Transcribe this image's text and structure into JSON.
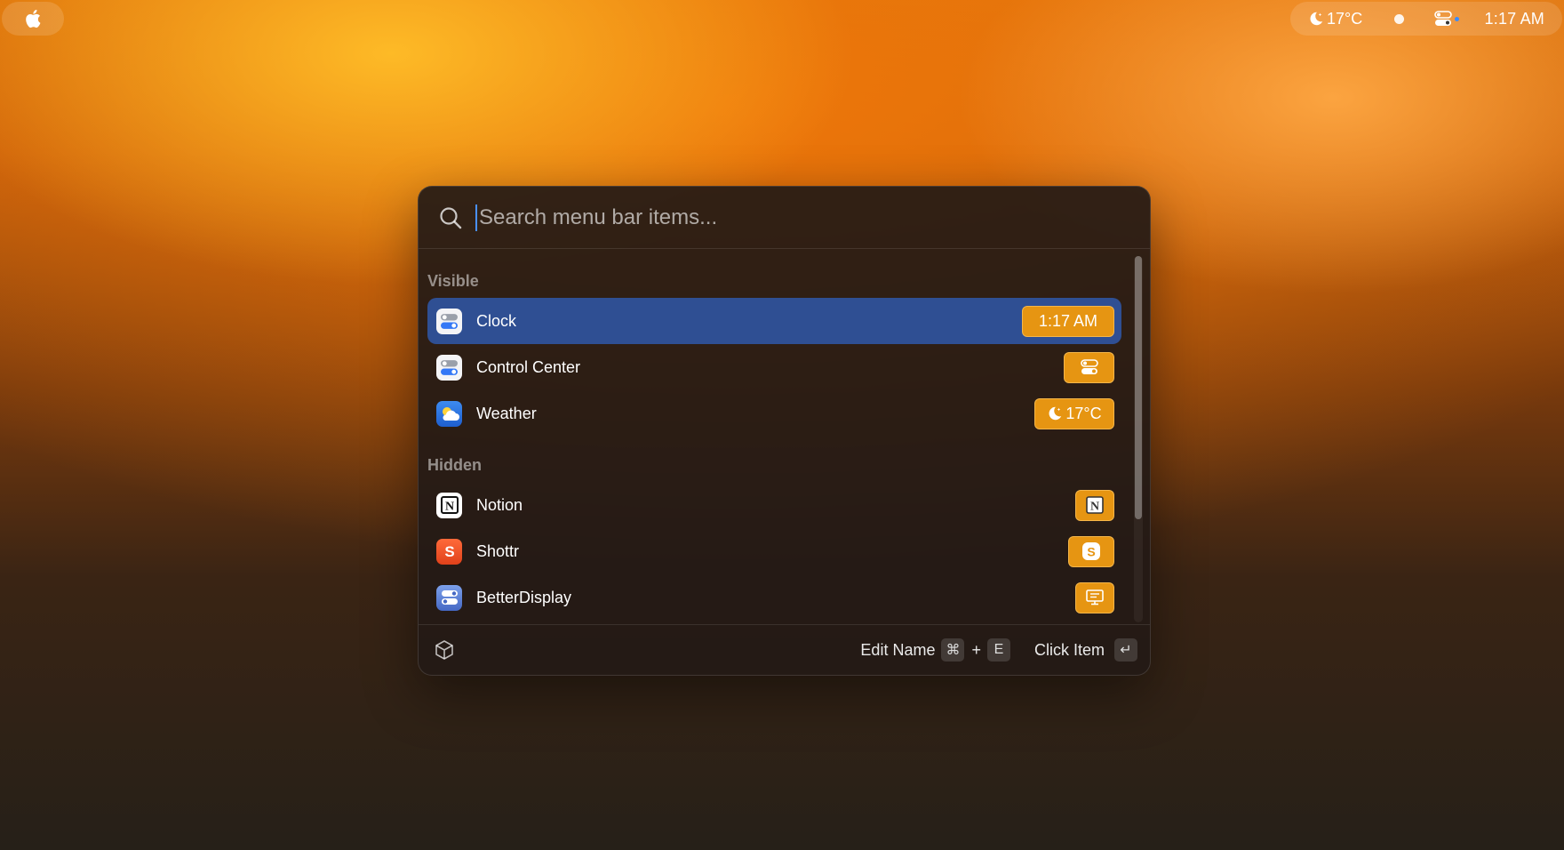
{
  "menubar": {
    "apple_icon": "apple-logo-icon",
    "weather_text": "17°C",
    "clock_text": "1:17 AM"
  },
  "search": {
    "placeholder": "Search menu bar items...",
    "value": ""
  },
  "sections": {
    "visible_title": "Visible",
    "hidden_title": "Hidden"
  },
  "items": [
    {
      "label": "Clock",
      "badge": "1:17 AM",
      "icon": "toggles-icon",
      "selected": true
    },
    {
      "label": "Control Center",
      "badge": "",
      "icon": "toggles-icon",
      "badge_icon": "toggles-icon"
    },
    {
      "label": "Weather",
      "badge": "17°C",
      "icon": "weather-icon",
      "badge_icon": "moon-icon"
    },
    {
      "label": "Notion",
      "badge": "",
      "icon": "notion-icon",
      "badge_icon": "notion-icon"
    },
    {
      "label": "Shottr",
      "badge": "",
      "icon": "shottr-icon",
      "badge_icon": "shottr-icon"
    },
    {
      "label": "BetterDisplay",
      "badge": "",
      "icon": "betterdisplay-icon",
      "badge_icon": "display-icon"
    }
  ],
  "footer": {
    "edit_name_label": "Edit Name",
    "edit_key_cmd": "⌘",
    "edit_plus": "+",
    "edit_key_letter": "E",
    "click_item_label": "Click Item",
    "click_key": "↵"
  },
  "colors": {
    "accent_selected": "#2f4f93",
    "badge": "#e69512",
    "caret": "#4a90ff"
  }
}
